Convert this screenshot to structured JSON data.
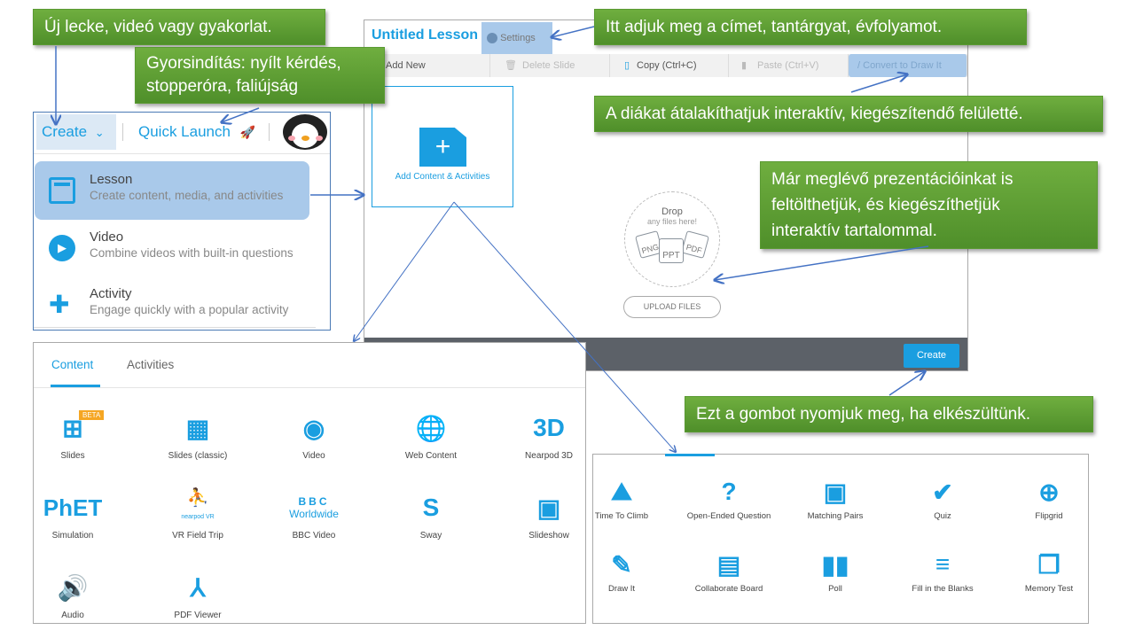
{
  "callouts": [
    "Új lecke, videó vagy gyakorlat.",
    "Gyorsindítás: nyílt kérdés,",
    "stopperóra, faliújság",
    "Itt adjuk meg a címet, tantárgyat, évfolyamot.",
    "A diákat átalakíthatjuk interaktív, kiegészítendő felületté.",
    "Már meglévő prezentációinkat is",
    "feltölthetjük, és kiegészíthetjük",
    "interaktív tartalommal.",
    "Ezt a gombot nyomjuk meg, ha elkészültünk."
  ],
  "create_menu": {
    "create_label": "Create",
    "quick_launch_label": "Quick Launch",
    "items": [
      {
        "title": "Lesson",
        "subtitle": "Create content, media, and activities",
        "icon": "lesson-icon"
      },
      {
        "title": "Video",
        "subtitle": "Combine videos with built-in questions",
        "icon": "video-icon"
      },
      {
        "title": "Activity",
        "subtitle": "Engage quickly with a popular activity",
        "icon": "puzzle-icon"
      }
    ]
  },
  "editor": {
    "title": "Untitled Lesson",
    "settings_label": "Settings",
    "toolbar": [
      "Add New",
      "Delete Slide",
      "Copy (Ctrl+C)",
      "Paste (Ctrl+V)",
      "Convert to Draw It"
    ],
    "add_content_label": "Add Content & Activities",
    "drop_title": "Drop",
    "drop_sub": "any files here!",
    "file_types": [
      "PNG",
      "PPT",
      "PDF"
    ],
    "upload_label": "UPLOAD FILES",
    "create_button": "Create"
  },
  "content_panel": {
    "tabs": [
      "Content",
      "Activities"
    ],
    "active_tab": "Content",
    "beta_badge": "BETA",
    "items": [
      "Slides",
      "Slides (classic)",
      "Video",
      "Web Content",
      "Nearpod 3D",
      "Simulation",
      "VR Field Trip",
      "BBC Video",
      "Sway",
      "Slideshow",
      "Audio",
      "PDF Viewer"
    ],
    "phet_logo": "PhET",
    "bbc_logo": "BBC",
    "bbc_sub": "Worldwide",
    "nearpod_vr": "nearpod VR"
  },
  "activities_panel": {
    "items": [
      "Time To Climb",
      "Open-Ended Question",
      "Matching Pairs",
      "Quiz",
      "Flipgrid",
      "Draw It",
      "Collaborate Board",
      "Poll",
      "Fill in the Blanks",
      "Memory Test"
    ]
  },
  "colors": {
    "accent": "#1a9ee0",
    "callout": "#5a9e32",
    "arrow": "#4472c4",
    "highlight": "#a9c9ea",
    "footer": "#5c6168"
  }
}
